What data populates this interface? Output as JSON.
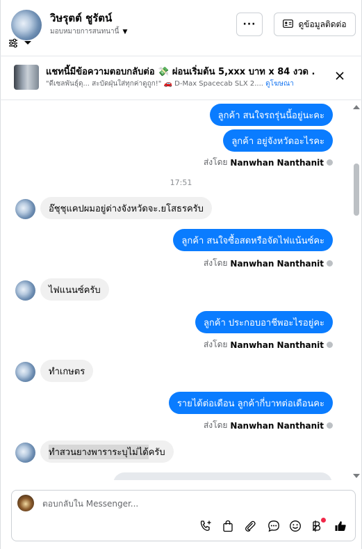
{
  "header": {
    "contact_name": "วิษรุตต์ ชูรัตน์",
    "assignee_label": "มอบหมายการสนทนานี้",
    "more_label": "···",
    "contact_info_label": "ดูข้อมูลติดต่อ"
  },
  "ad": {
    "title": "แชทนี้มีข้อความตอบกลับต่อ 💸 ผ่อนเริ่มต้น 5,xxx บาท x 84 งวด .",
    "subtitle": "\"ดีเซลพันธุ์ดุ... สะบัดฝุ่นใส่ทุกค่าดูถูก!\" 🚗 D-Max Spacecab SLX 2....",
    "badge": "ดูโฆษณา"
  },
  "messages": {
    "m1": "ลูกค้า  สนใจรถรุ่นนี้อยู่นะคะ",
    "m2": "ลูกค้า  อยู่จังหวัดอะไรคะ",
    "sent1_prefix": "ส่งโดย",
    "sent1_name": "Nanwhan Nanthanit",
    "time": "17:51",
    "m3": "อ๊ชุชุแคปผมอยู่ต่างจังหวัดจะ.ยโสธรครับ",
    "m4": "ลูกค้า สนใจซื้อสดหรือจัดไฟแน้นซ์คะ",
    "sent2_prefix": "ส่งโดย",
    "sent2_name": "Nanwhan Nanthanit",
    "m5": "ไฟแนนซ์ครับ",
    "m6": "ลูกค้า ประกอบอาชีพอะไรอยู่คะ",
    "sent3_prefix": "ส่งโดย",
    "sent3_name": "Nanwhan Nanthanit",
    "m7": "ทำเกษตร",
    "m8": "รายได้ต่อเดือน  ลูกค้ากี่บาทต่อเดือนคะ",
    "sent4_prefix": "ส่งโดย",
    "sent4_name": "Nanwhan Nanthanit",
    "m9_selected": "ทำสวนยางพาราระบุไม่ได้",
    "m9_rest": "ครับ"
  },
  "composer": {
    "placeholder": "ตอบกลับใน Messenger..."
  },
  "colors": {
    "accent": "#0a7cff",
    "incoming_bubble": "#f0f0f0",
    "notification_dot": "#f02849"
  },
  "icons": [
    "filter-icon",
    "chevron-down-icon",
    "contact-card-icon",
    "close-icon",
    "phone-add-icon",
    "bag-icon",
    "paperclip-icon",
    "chat-bubble-icon",
    "emoji-icon",
    "baht-icon",
    "thumbs-up-icon"
  ]
}
